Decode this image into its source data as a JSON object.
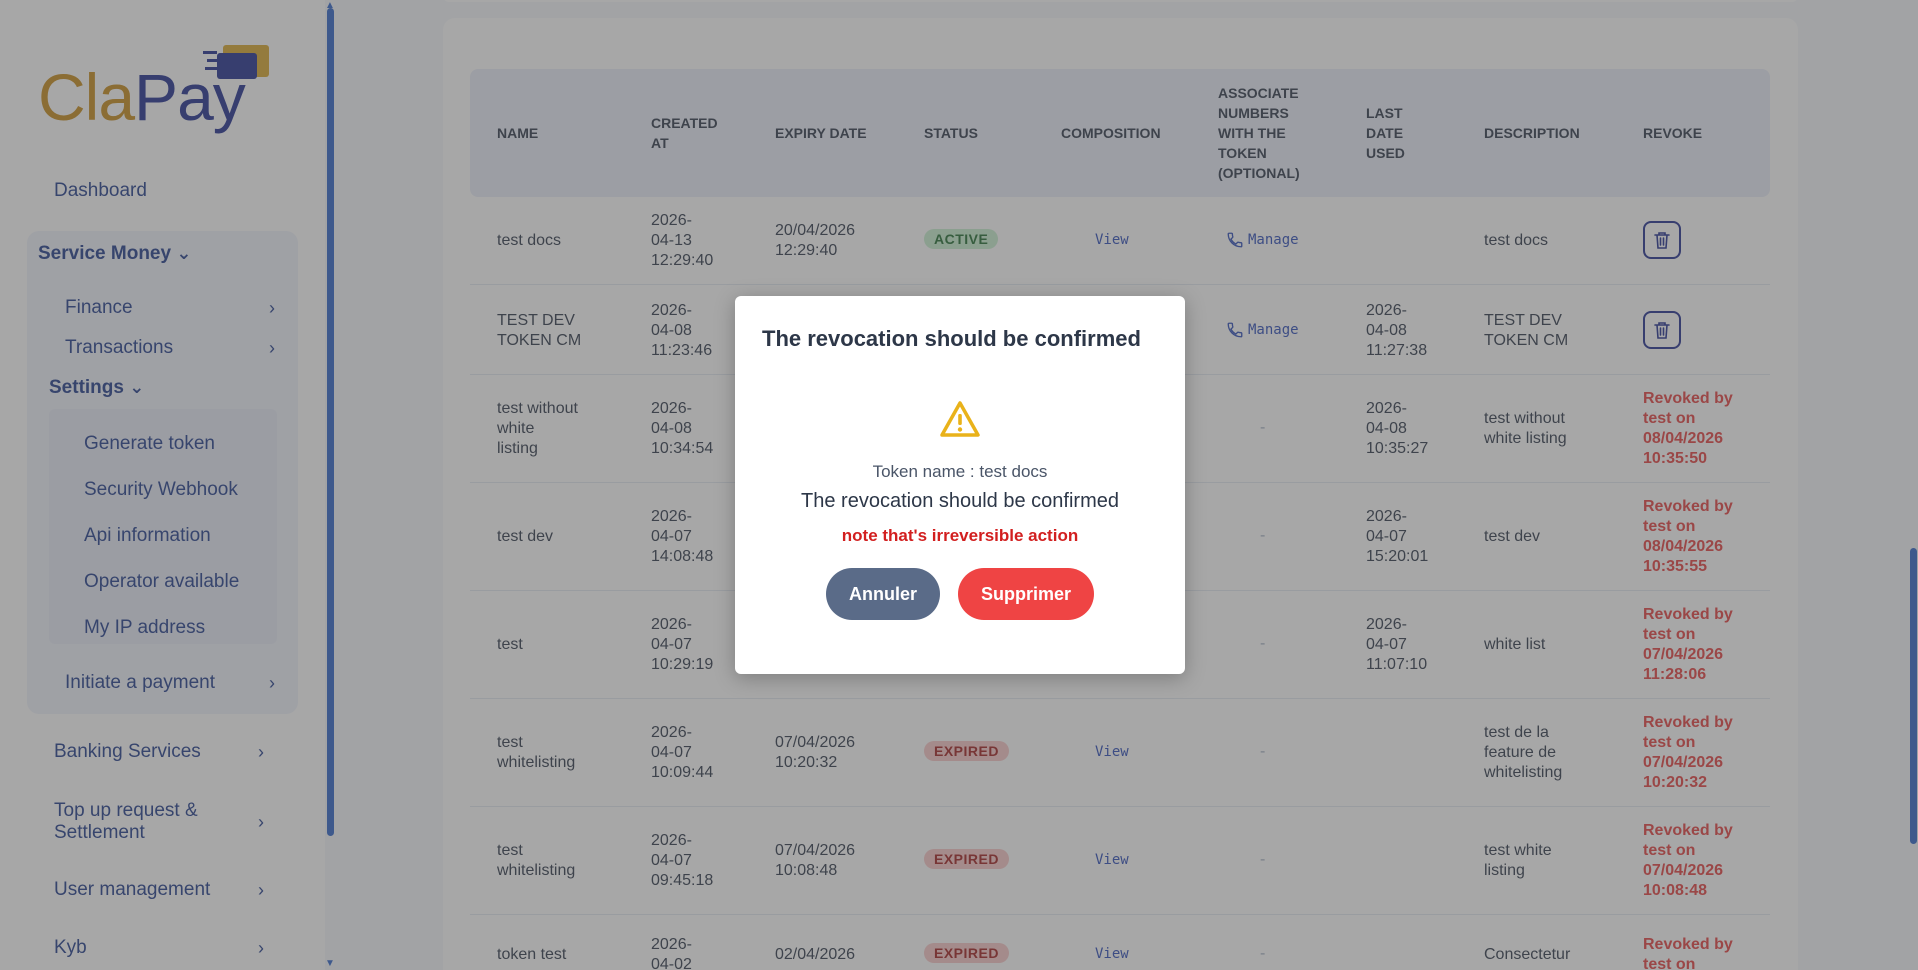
{
  "brand": {
    "part1": "Cla",
    "part2": "Pay"
  },
  "sidebar": {
    "dashboard": "Dashboard",
    "service_money": "Service Money",
    "finance": "Finance",
    "transactions": "Transactions",
    "settings": "Settings",
    "settings_items": [
      "Generate token",
      "Security Webhook",
      "Api information",
      "Operator available",
      "My IP address"
    ],
    "initiate_payment": "Initiate a payment",
    "banking_services": "Banking Services",
    "topup_line1": "Top up request &",
    "topup_line2": "Settlement",
    "user_management": "User management",
    "kyb": "Kyb"
  },
  "table": {
    "headers": {
      "name": "NAME",
      "created_1": "CREATED",
      "created_2": "AT",
      "expiry": "EXPIRY DATE",
      "status": "STATUS",
      "composition": "COMPOSITION",
      "assoc_1": "ASSOCIATE",
      "assoc_2": "NUMBERS",
      "assoc_3": "WITH THE",
      "assoc_4": "TOKEN",
      "assoc_5": "(OPTIONAL)",
      "last_1": "LAST",
      "last_2": "DATE",
      "last_3": "USED",
      "description": "DESCRIPTION",
      "revoke": "REVOKE"
    },
    "rows": [
      {
        "name": [
          "test docs"
        ],
        "created": [
          "2026-",
          "04-13",
          "12:29:40"
        ],
        "expiry": [
          "20/04/2026",
          "12:29:40"
        ],
        "status": "ACTIVE",
        "composition": "View",
        "assoc": "Manage",
        "last": [],
        "desc": [
          "test docs"
        ],
        "revoke": []
      },
      {
        "name": [
          "TEST DEV",
          "TOKEN CM"
        ],
        "created": [
          "2026-",
          "04-08",
          "11:23:46"
        ],
        "expiry": [],
        "status": "",
        "composition": "",
        "assoc": "Manage",
        "last": [
          "2026-",
          "04-08",
          "11:27:38"
        ],
        "desc": [
          "TEST DEV",
          "TOKEN CM"
        ],
        "revoke": []
      },
      {
        "name": [
          "test without",
          "white",
          "listing"
        ],
        "created": [
          "2026-",
          "04-08",
          "10:34:54"
        ],
        "expiry": [],
        "status": "",
        "composition": "",
        "assoc": "-",
        "last": [
          "2026-",
          "04-08",
          "10:35:27"
        ],
        "desc": [
          "test without",
          "white listing"
        ],
        "revoke": [
          "Revoked by",
          "test on",
          "08/04/2026",
          "10:35:50"
        ]
      },
      {
        "name": [
          "test dev"
        ],
        "created": [
          "2026-",
          "04-07",
          "14:08:48"
        ],
        "expiry": [],
        "status": "",
        "composition": "",
        "assoc": "-",
        "last": [
          "2026-",
          "04-07",
          "15:20:01"
        ],
        "desc": [
          "test dev"
        ],
        "revoke": [
          "Revoked by",
          "test on",
          "08/04/2026",
          "10:35:55"
        ]
      },
      {
        "name": [
          "test"
        ],
        "created": [
          "2026-",
          "04-07",
          "10:29:19"
        ],
        "expiry": [],
        "status": "",
        "composition": "",
        "assoc": "-",
        "last": [
          "2026-",
          "04-07",
          "11:07:10"
        ],
        "desc": [
          "white list"
        ],
        "revoke": [
          "Revoked by",
          "test on",
          "07/04/2026",
          "11:28:06"
        ]
      },
      {
        "name": [
          "test",
          "whitelisting"
        ],
        "created": [
          "2026-",
          "04-07",
          "10:09:44"
        ],
        "expiry": [
          "07/04/2026",
          "10:20:32"
        ],
        "status": "EXPIRED",
        "composition": "View",
        "assoc": "-",
        "last": [],
        "desc": [
          "test de la",
          "feature de",
          "whitelisting"
        ],
        "revoke": [
          "Revoked by",
          "test on",
          "07/04/2026",
          "10:20:32"
        ]
      },
      {
        "name": [
          "test",
          "whitelisting"
        ],
        "created": [
          "2026-",
          "04-07",
          "09:45:18"
        ],
        "expiry": [
          "07/04/2026",
          "10:08:48"
        ],
        "status": "EXPIRED",
        "composition": "View",
        "assoc": "-",
        "last": [],
        "desc": [
          "test white",
          "listing"
        ],
        "revoke": [
          "Revoked by",
          "test on",
          "07/04/2026",
          "10:08:48"
        ]
      },
      {
        "name": [
          "token test"
        ],
        "created": [
          "2026-",
          "04-02"
        ],
        "expiry": [
          "02/04/2026"
        ],
        "status": "EXPIRED",
        "composition": "View",
        "assoc": "-",
        "last": [],
        "desc": [
          "Consectetur"
        ],
        "revoke": [
          "Revoked by",
          "test on"
        ]
      }
    ]
  },
  "modal": {
    "title": "The revocation should be confirmed",
    "token_line": "Token name : test docs",
    "confirm_text": "The revocation should be confirmed",
    "note": "note that's irreversible action",
    "cancel_label": "Annuler",
    "delete_label": "Supprimer"
  },
  "icons": {
    "warning": "warning-triangle-icon",
    "trash": "trash-icon",
    "phone": "phone-icon",
    "chevron_right": "chevron-right-icon",
    "chevron_down": "chevron-down-icon"
  },
  "colors": {
    "brand_blue": "#1f2c8f",
    "brand_gold": "#c68a18",
    "nav_text": "#1f3a8a",
    "danger": "#ef4444",
    "cancel": "#5a6b88",
    "warning": "#e9b21a"
  }
}
